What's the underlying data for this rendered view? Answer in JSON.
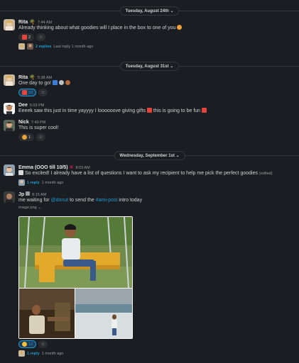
{
  "dividers": {
    "d1": "Tuesday, August 24th",
    "d2": "Tuesday, August 31st",
    "d3": "Wednesday, September 1st"
  },
  "chevron": "⌄",
  "messages": {
    "m1": {
      "name": "Rita",
      "time": "7:44 AM",
      "text": "Already thinking about what goodies will I place in the box to one of you",
      "reactions": [
        {
          "icon": "gift-emoji",
          "count": "2"
        }
      ],
      "thread": {
        "replies": "2 replies",
        "last": "Last reply 1 month ago"
      }
    },
    "m2": {
      "name": "Rita",
      "time": "5:38 AM",
      "text": "One day to go!",
      "reactions": [
        {
          "icon": "gift-emoji",
          "count": "10"
        }
      ]
    },
    "m3": {
      "name": "Dee",
      "time": "5:03 PM",
      "text_a": "Eeeek saw this just in time yayyyy I loooooove giving gifts",
      "text_b": "this is going to be fun"
    },
    "m4": {
      "name": "Nick",
      "time": "7:49 PM",
      "text": "This is super cool!",
      "reactions": [
        {
          "icon": "party-emoji",
          "count": "1"
        }
      ]
    },
    "m5": {
      "name": "Emma (OOO till 10/5)",
      "time": "8:03 AM",
      "text": "So excited! I already have a list of questions I want to ask my recipient to help me pick the perfect goodies",
      "edited": "(edited)",
      "thread": {
        "replies": "1 reply",
        "last": "1 month ago"
      }
    },
    "m6": {
      "name": "Jp",
      "time": "8:15 AM",
      "text_a": "me waiting for",
      "mention1": "@donut",
      "text_b": "to send the",
      "mention2": "#ami-post",
      "text_c": "intro today",
      "file": "image.png",
      "reactions": [
        {
          "icon": "smile-emoji",
          "count": "13"
        }
      ],
      "thread": {
        "replies": "1 reply",
        "last": "1 month ago"
      }
    }
  },
  "colors": {
    "background": "#1a1d21",
    "link": "#1d9bd1",
    "divider": "#35373b"
  }
}
